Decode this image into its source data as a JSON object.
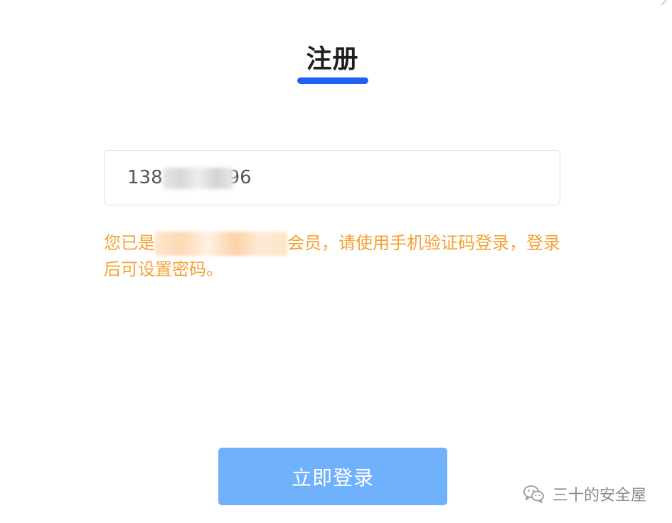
{
  "dialog": {
    "close_icon": "close-icon",
    "title": "注册"
  },
  "phone_field": {
    "value": "138••••••96"
  },
  "notice": {
    "prefix": "您已是",
    "suffix": "会员，请使用手机验证码登录，登录后可设置密码。"
  },
  "login_button": {
    "label": "立即登录"
  },
  "watermark": {
    "icon": "wechat-icon",
    "text": "三十的安全屋"
  },
  "colors": {
    "accent": "#2061f0",
    "button": "#6fb1fb",
    "warning_text": "#f5a033",
    "border": "#dcdfe6"
  }
}
